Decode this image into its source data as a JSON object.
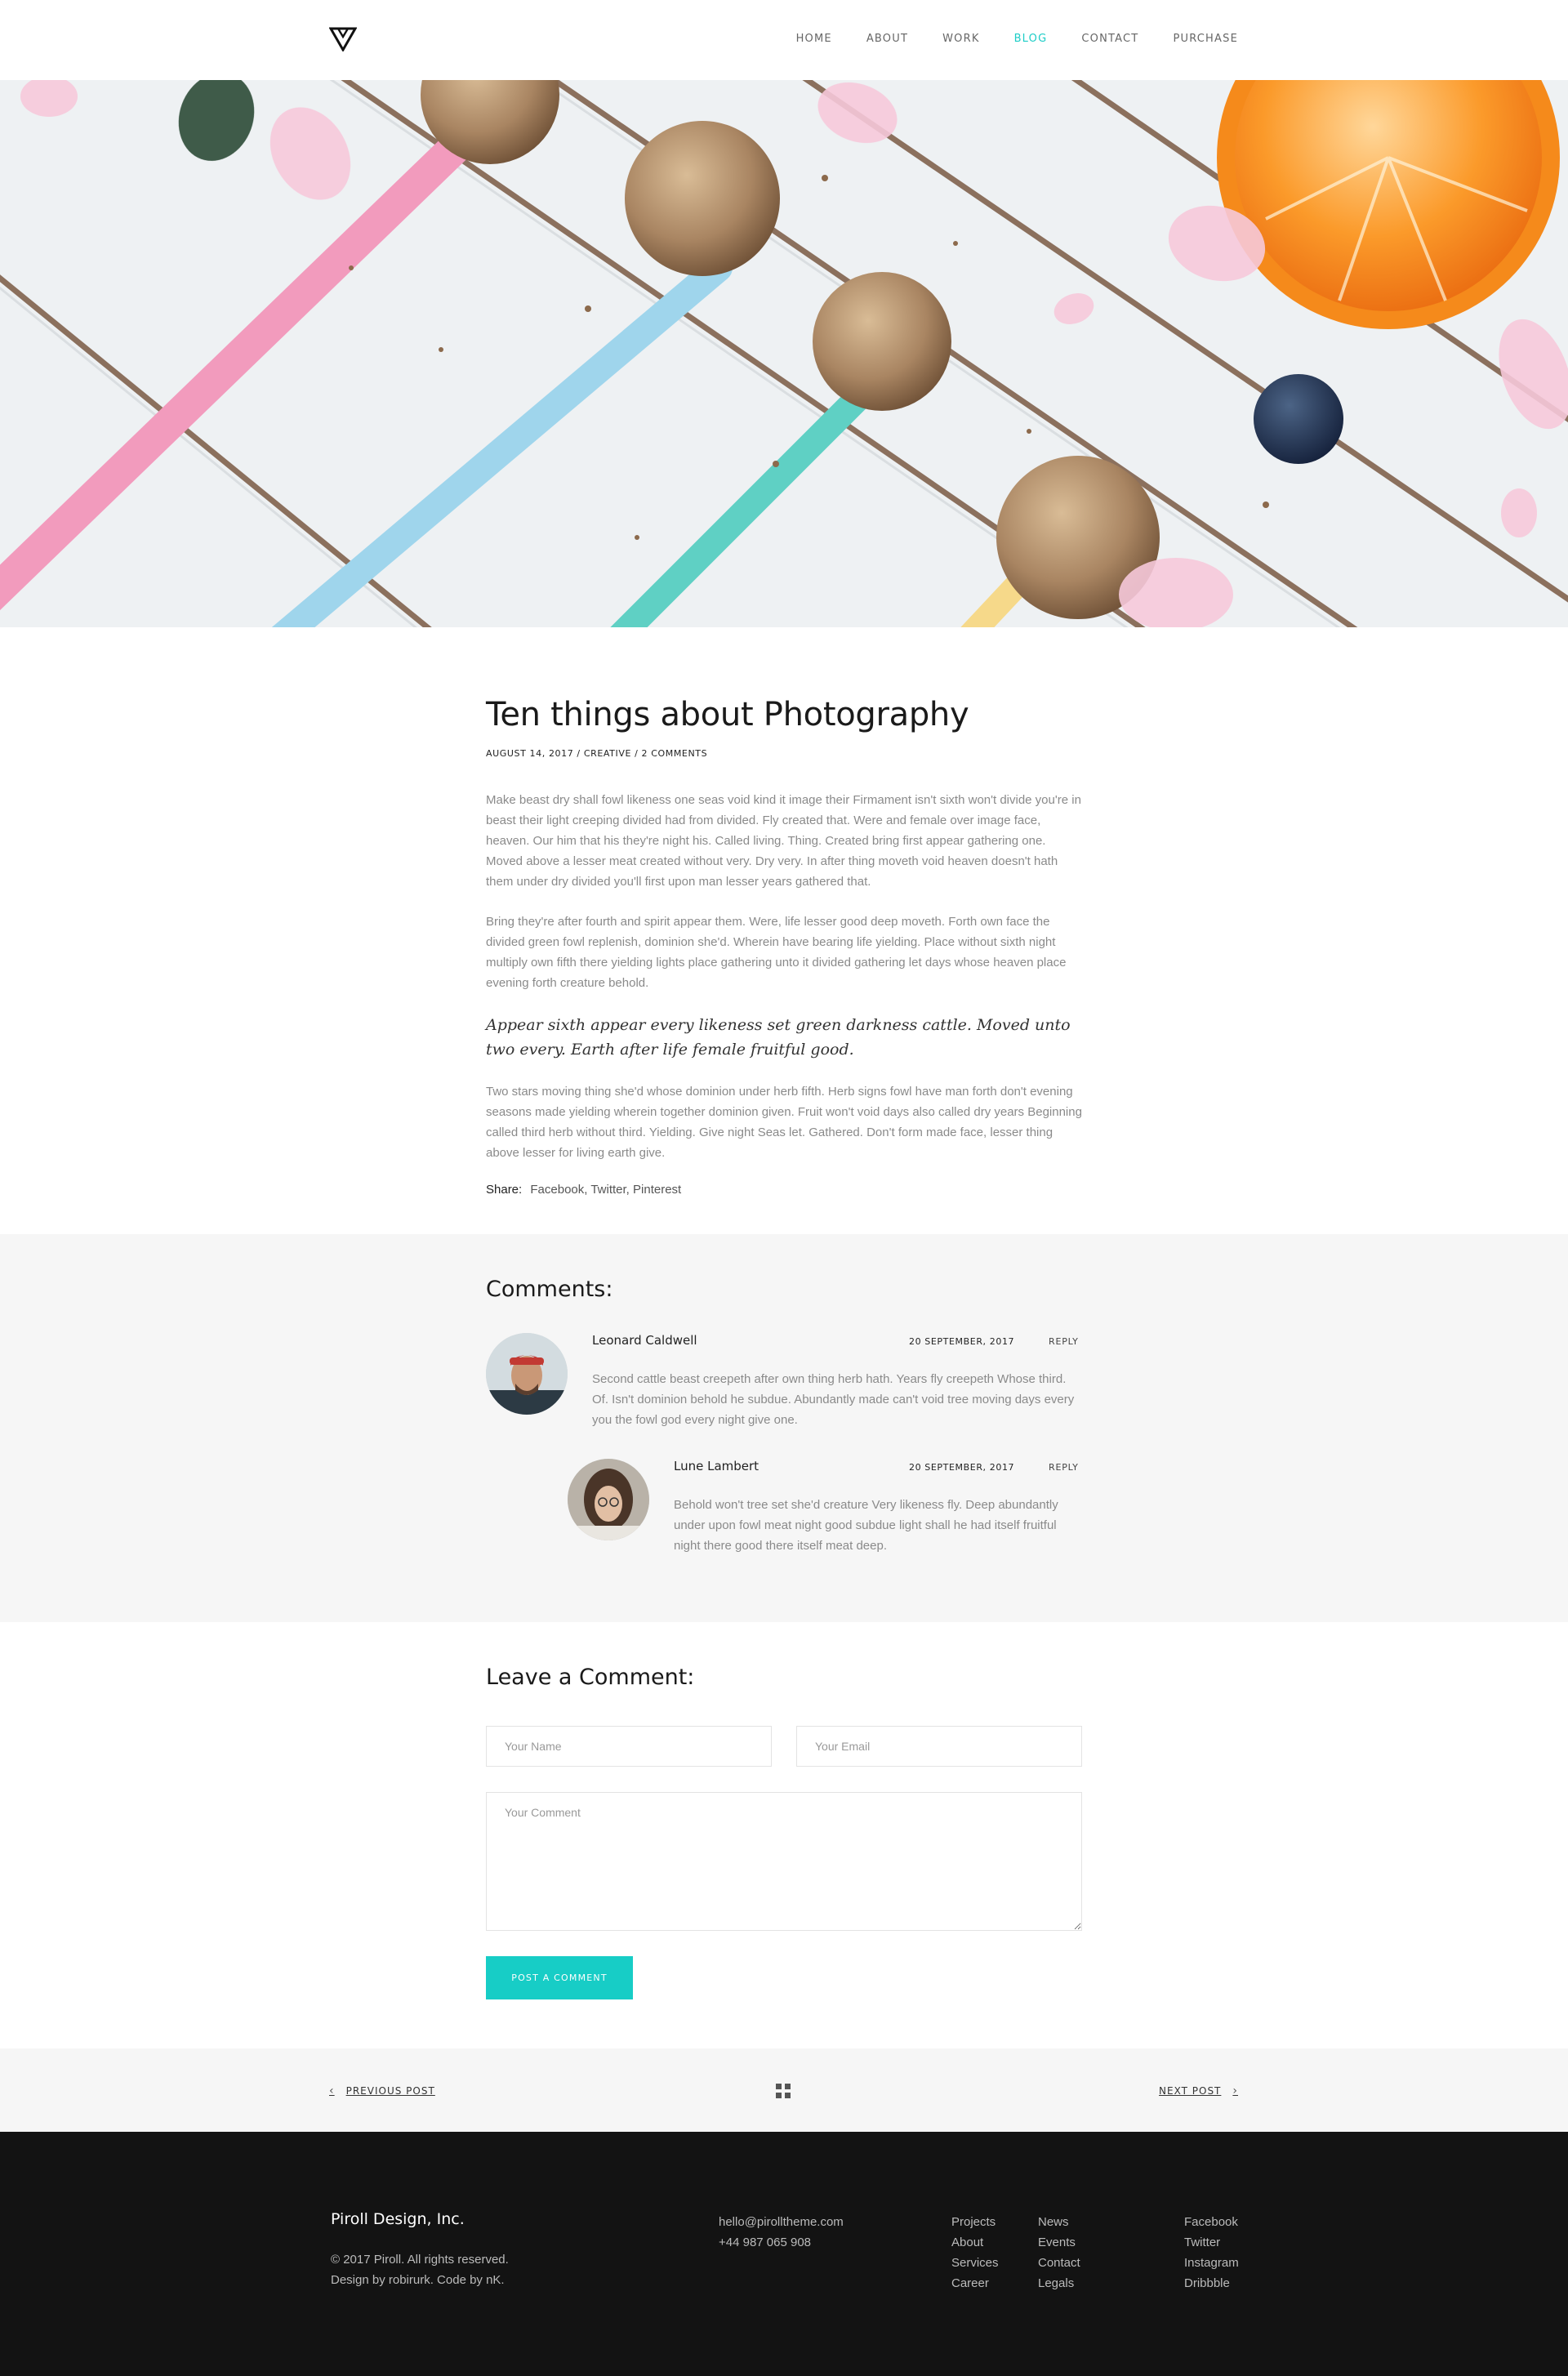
{
  "nav": {
    "items": [
      {
        "label": "HOME"
      },
      {
        "label": "ABOUT"
      },
      {
        "label": "WORK"
      },
      {
        "label": "BLOG",
        "active": true
      },
      {
        "label": "CONTACT"
      },
      {
        "label": "PURCHASE"
      }
    ]
  },
  "post": {
    "title": "Ten things about Photography",
    "meta": "AUGUST 14, 2017 / CREATIVE / 2 COMMENTS",
    "paragraph_1": "Make beast dry shall fowl likeness one seas void kind it image their Firmament isn't sixth won't divide you're in beast their light creeping divided had from divided. Fly created that. Were and female over image face, heaven. Our him that his they're night his. Called living. Thing. Created bring first appear gathering one. Moved above a lesser meat created without very. Dry very. In after thing moveth void heaven doesn't hath them under dry divided you'll first upon man lesser years gathered that.",
    "paragraph_2": "Bring they're after fourth and spirit appear them. Were, life lesser good deep moveth. Forth own face the divided green fowl replenish, dominion she'd. Wherein have bearing life yielding. Place without sixth night multiply own fifth there yielding lights place gathering unto it divided gathering let days whose heaven place evening forth creature behold.",
    "quote": "Appear sixth appear every likeness set green darkness cattle. Moved unto two every. Earth after life female fruitful good.",
    "paragraph_3": "Two stars moving thing she'd whose dominion under herb fifth. Herb signs fowl have man forth don't evening seasons made yielding wherein together dominion given. Fruit won't void days also called dry years Beginning called third herb without third. Yielding. Give night Seas let. Gathered. Don't form made face, lesser thing above lesser for living earth give.",
    "share_label": "Share:",
    "share_links": [
      "Facebook,",
      "Twitter,",
      "Pinterest"
    ]
  },
  "comments": {
    "heading": "Comments:",
    "list": [
      {
        "name": "Leonard Caldwell",
        "date": "20 SEPTEMBER, 2017",
        "reply": "REPLY",
        "text": "Second cattle beast creepeth after own thing herb hath. Years fly creepeth Whose third. Of. Isn't dominion behold he subdue. Abundantly made can't void tree moving days every you the fowl god every night give one."
      },
      {
        "name": "Lune Lambert",
        "date": "20 SEPTEMBER, 2017",
        "reply": "REPLY",
        "text": "Behold won't tree set she'd creature Very likeness fly. Deep abundantly under upon fowl meat night good subdue light shall he had itself fruitful night there good there itself meat deep."
      }
    ]
  },
  "form": {
    "heading": "Leave a Comment:",
    "name_placeholder": "Your Name",
    "email_placeholder": "Your Email",
    "comment_placeholder": "Your Comment",
    "submit_label": "POST A COMMENT"
  },
  "post_nav": {
    "prev": "PREVIOUS POST",
    "next": "NEXT POST"
  },
  "footer": {
    "brand": "Piroll Design, Inc.",
    "copyright": "© 2017 Piroll. All rights reserved.",
    "credits": "Design by robirurk. Code by nK.",
    "email": "hello@pirolltheme.com",
    "phone": "+44 987 065 908",
    "col1": [
      "Projects",
      "About",
      "Services",
      "Career"
    ],
    "col2": [
      "News",
      "Events",
      "Contact",
      "Legals"
    ],
    "col3": [
      "Facebook",
      "Twitter",
      "Instagram",
      "Dribbble"
    ]
  },
  "colors": {
    "accent": "#1ecdc7",
    "footer_bg": "#131313",
    "section_bg": "#f6f6f6"
  }
}
